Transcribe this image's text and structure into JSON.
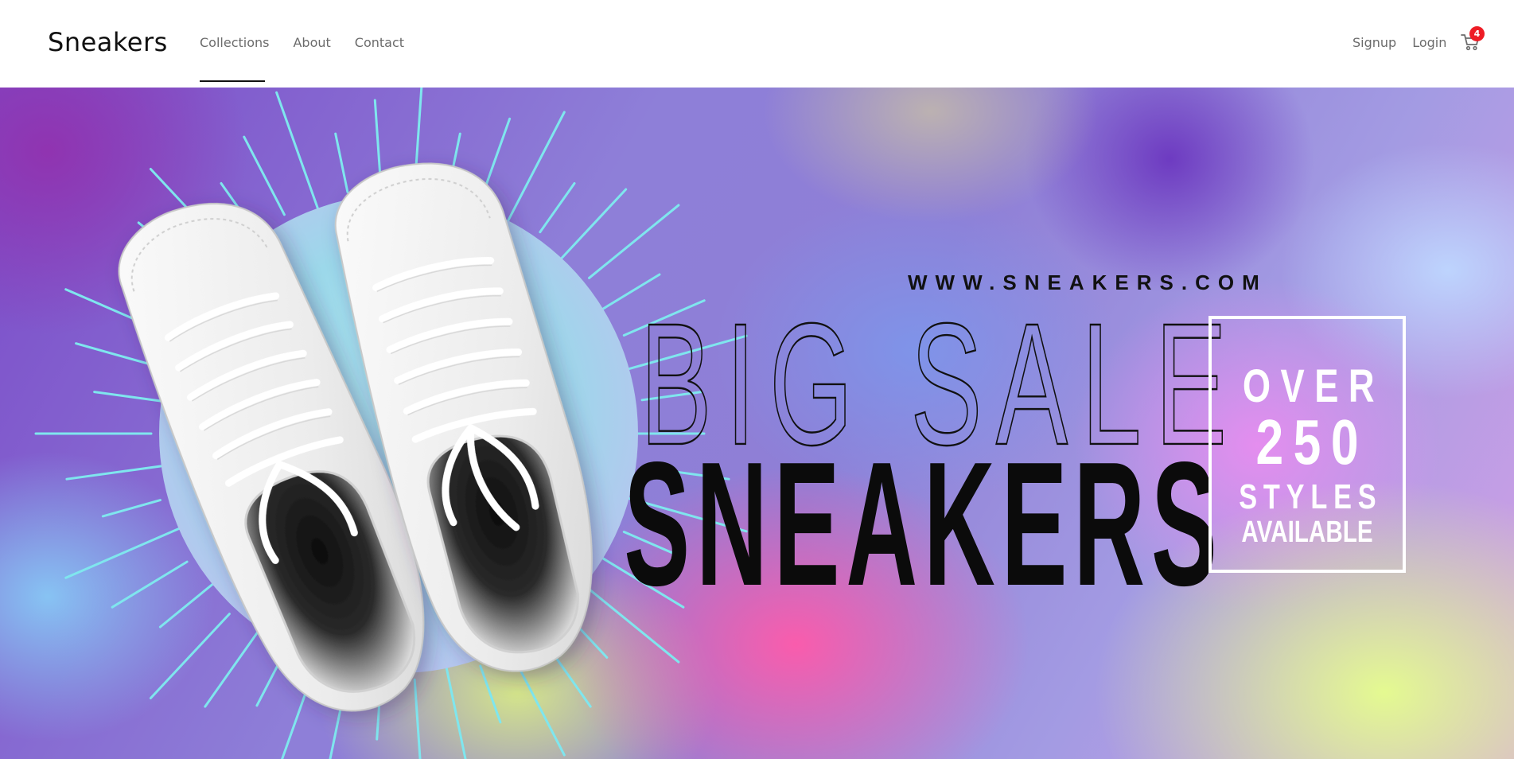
{
  "header": {
    "brand": "Sneakers",
    "nav": [
      {
        "label": "Collections",
        "active": true
      },
      {
        "label": "About",
        "active": false
      },
      {
        "label": "Contact",
        "active": false
      }
    ],
    "signup_label": "Signup",
    "login_label": "Login",
    "cart_count": "4"
  },
  "hero": {
    "url": "WWW.SNEAKERS.COM",
    "headline_outline": "BIG SALE",
    "headline_solid": "SNEAKERS",
    "promo": {
      "line1": "OVER",
      "line2": "250",
      "line3": "STYLES",
      "line4": "AVAILABLE"
    }
  },
  "colors": {
    "badge": "#ee1c25",
    "ray": "#7fe6ee",
    "text_dark": "#0b0b0b"
  }
}
